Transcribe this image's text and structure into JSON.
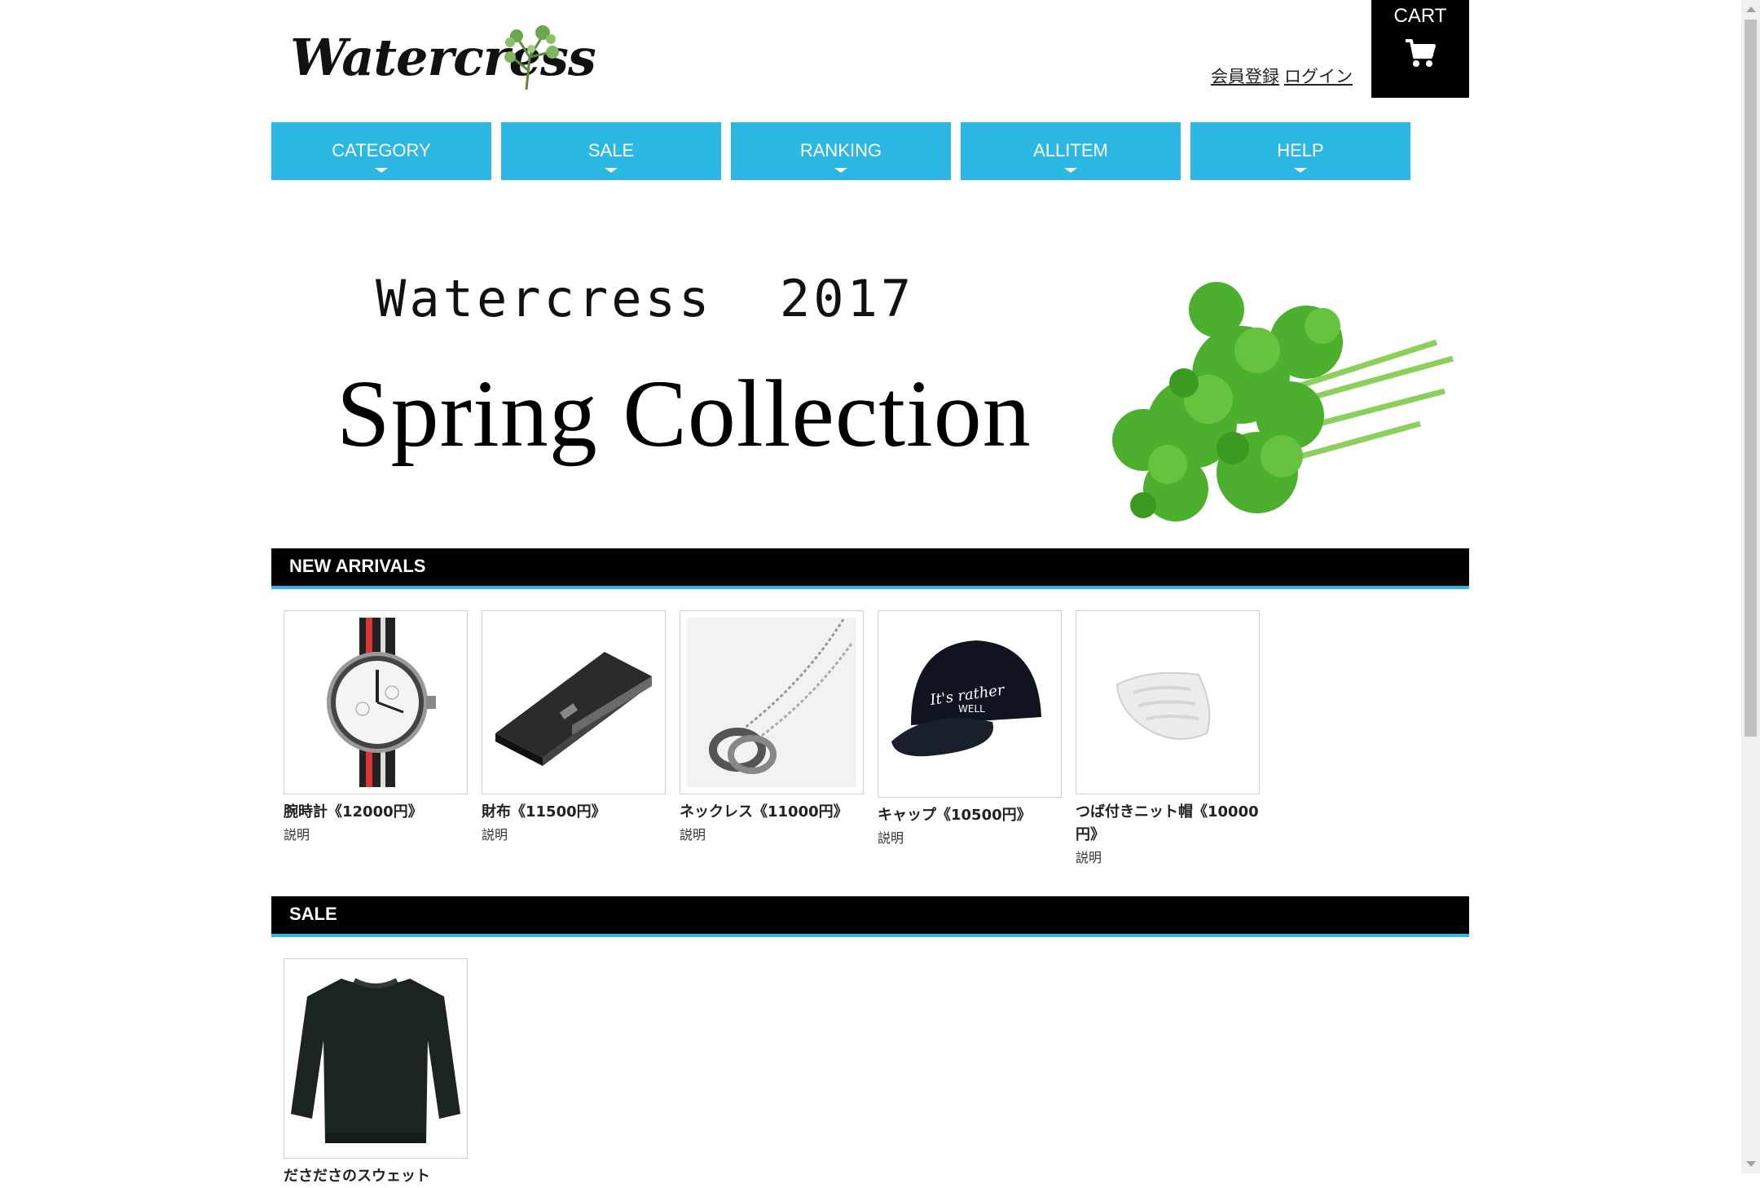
{
  "header": {
    "logo_text": "Watercress",
    "register_label": "会員登録",
    "login_label": "ログイン",
    "cart_label": "CART"
  },
  "nav": {
    "items": [
      {
        "label": "CATEGORY"
      },
      {
        "label": "SALE"
      },
      {
        "label": "RANKING"
      },
      {
        "label": "ALLITEM"
      },
      {
        "label": "HELP"
      }
    ]
  },
  "hero": {
    "line1": "Watercress  2017",
    "line2": "Spring Collection"
  },
  "new_arrivals": {
    "title": "NEW ARRIVALS",
    "items": [
      {
        "name": "腕時計《12000円》",
        "desc": "説明",
        "icon": "wristwatch-image"
      },
      {
        "name": "財布《11500円》",
        "desc": "説明",
        "icon": "wallet-image"
      },
      {
        "name": "ネックレス《11000円》",
        "desc": "説明",
        "icon": "necklace-image"
      },
      {
        "name": "キャップ《10500円》",
        "desc": "説明",
        "icon": "cap-image"
      },
      {
        "name": "つば付きニット帽《10000円》",
        "desc": "説明",
        "icon": "knit-hat-image"
      }
    ]
  },
  "sale": {
    "title": "SALE",
    "items": [
      {
        "name": "ださださのスウェット",
        "desc": "",
        "icon": "sweatshirt-image"
      }
    ]
  },
  "colors": {
    "accent": "#2cb7e4",
    "bar": "#000000"
  }
}
